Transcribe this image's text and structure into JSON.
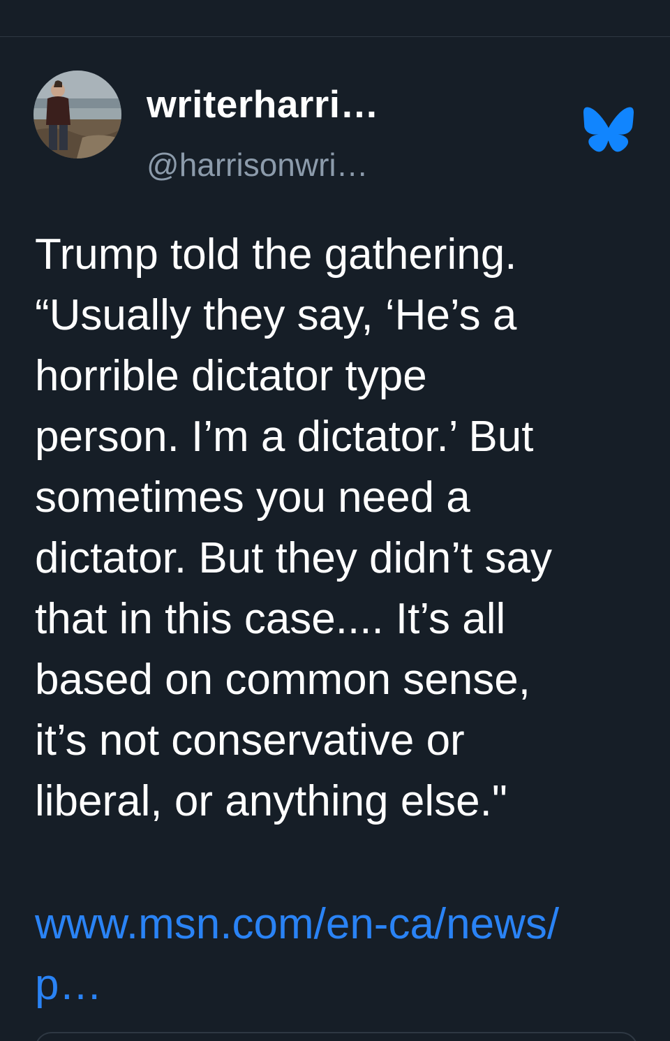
{
  "author": {
    "display_name": "writerharri…",
    "handle": "@harrisonwri…",
    "avatar": "profile-photo"
  },
  "app": {
    "logo_icon": "bluesky-butterfly-icon",
    "accent_color": "#1185fe"
  },
  "post": {
    "text": "Trump told the gathering.\n“Usually they say, ‘He’s a\nhorrible dictator type\nperson. I’m a dictator.’ But\nsometimes you need a\ndictator. But they didn’t say\nthat in this case.... It’s all\nbased on common sense,\nit’s not conservative or\nliberal, or anything else.\"",
    "link_text": "www.msn.com/en-ca/news/\np…"
  },
  "colors": {
    "background": "#161e27",
    "text": "#ffffff",
    "muted": "#8c9bab",
    "link": "#2a83f5"
  }
}
